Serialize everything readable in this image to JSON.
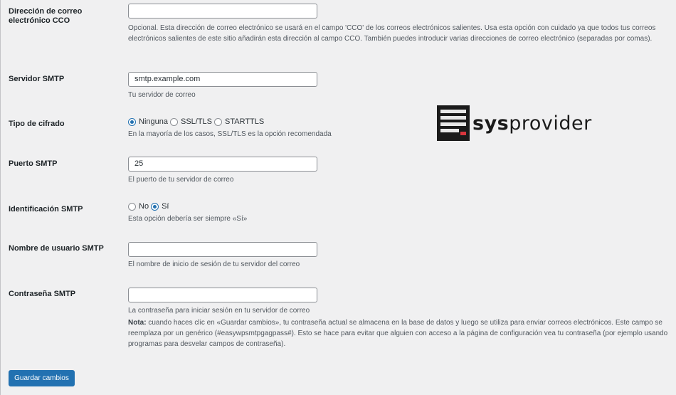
{
  "fields": {
    "bcc": {
      "label": "Dirección de correo electrónico CCO",
      "value": "",
      "description": "Opcional. Esta dirección de correo electrónico se usará en el campo 'CCO' de los correos electrónicos salientes. Usa esta opción con cuidado ya que todos tus correos electrónicos salientes de este sitio añadirán esta dirección al campo CCO. También puedes introducir varias direcciones de correo electrónico (separadas por comas)."
    },
    "smtp_server": {
      "label": "Servidor SMTP",
      "value": "smtp.example.com",
      "description": "Tu servidor de correo"
    },
    "encryption": {
      "label": "Tipo de cifrado",
      "options": [
        "Ninguna",
        "SSL/TLS",
        "STARTTLS"
      ],
      "selected": "Ninguna",
      "description": "En la mayoría de los casos, SSL/TLS es la opción recomendada"
    },
    "smtp_port": {
      "label": "Puerto SMTP",
      "value": "25",
      "description": "El puerto de tu servidor de correo"
    },
    "smtp_auth": {
      "label": "Identificación SMTP",
      "options": [
        "No",
        "Sí"
      ],
      "selected": "Sí",
      "description": "Esta opción debería ser siempre «Sí»"
    },
    "smtp_username": {
      "label": "Nombre de usuario SMTP",
      "value": "",
      "description": "El nombre de inicio de sesión de tu servidor del correo"
    },
    "smtp_password": {
      "label": "Contraseña SMTP",
      "value": "",
      "description": "La contraseña para iniciar sesión en tu servidor de correo",
      "note_label": "Nota:",
      "note_text": "cuando haces clic en «Guardar cambios», tu contraseña actual se almacena en la base de datos y luego se utiliza para enviar correos electrónicos. Este campo se reemplaza por un genérico (#easywpsmtpgagpass#). Esto se hace para evitar que alguien con acceso a la página de configuración vea tu contraseña (por ejemplo usando programas para desvelar campos de contraseña)."
    }
  },
  "save_button": "Guardar cambios",
  "logo": {
    "bold": "sys",
    "regular": "provider",
    "icon": "server-rack-icon"
  },
  "colors": {
    "accent": "#2271b1",
    "background": "#f0f0f1",
    "logo_red": "#d9363e"
  }
}
